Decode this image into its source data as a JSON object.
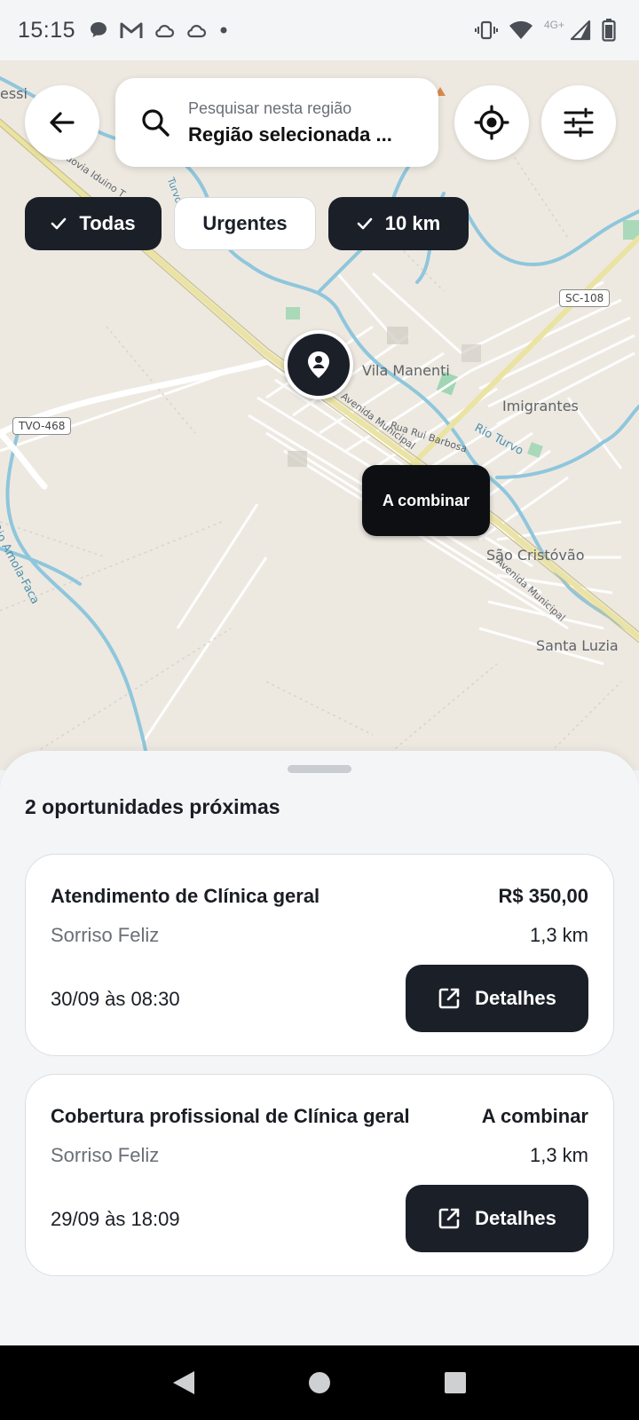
{
  "status_bar": {
    "time": "15:15",
    "network_label": "4G+",
    "notification_icons": [
      "chat-icon",
      "gmail-icon",
      "cloud-icon",
      "cloud-icon",
      "dot-icon"
    ],
    "system_icons": [
      "vibrate-icon",
      "wifi-icon",
      "signal-icon",
      "battery-icon"
    ]
  },
  "map": {
    "labels": {
      "vila_manenti": "Vila Manenti",
      "imigrantes": "Imigrantes",
      "sao_cristovao": "São Cristóvão",
      "santa_luzia": "Santa Luzia",
      "essi": "essi",
      "rua_rui_barbosa": "Rua Rui Barbosa",
      "avenida_municipal_1": "Avenida Municipal",
      "avenida_municipal_2": "Avenida Municipal",
      "rio_turvo": "Rio Turvo",
      "rio_amola_faca": "Rio Amola-Faca",
      "rodovia": "Rodovia Iduino T",
      "turvo": "Turvo"
    },
    "road_badges": {
      "sc108": "SC-108",
      "tvo468": "TVO-468"
    },
    "price_marker": "A combinar"
  },
  "search": {
    "placeholder": "Pesquisar nesta região",
    "value": "Região selecionada ..."
  },
  "filters": {
    "todas": "Todas",
    "urgentes": "Urgentes",
    "radius": "10 km"
  },
  "sheet": {
    "title": "2 oportunidades próximas",
    "cards": [
      {
        "title": "Atendimento de Clínica geral",
        "price": "R$ 350,00",
        "company": "Sorriso Feliz",
        "distance": "1,3 km",
        "date": "30/09 às 08:30",
        "button": "Detalhes"
      },
      {
        "title": "Cobertura profissional de Clínica geral",
        "price": "A combinar",
        "company": "Sorriso Feliz",
        "distance": "1,3 km",
        "date": "29/09 às 18:09",
        "button": "Detalhes"
      }
    ]
  },
  "colors": {
    "primary_dark": "#1b1f28",
    "map_background": "#ede9e1",
    "river": "#8fc6dc",
    "highway": "#efe39a"
  }
}
